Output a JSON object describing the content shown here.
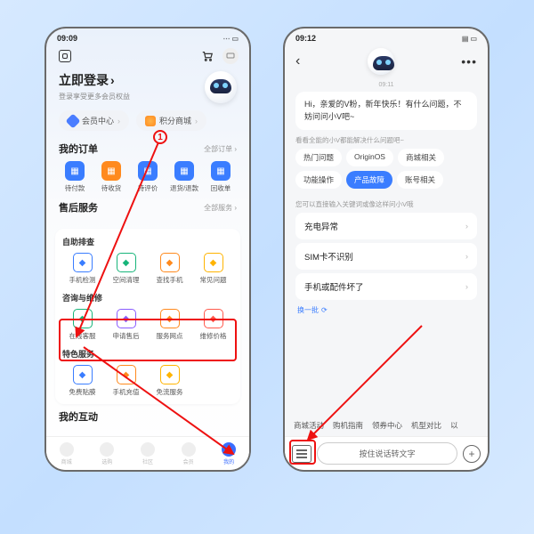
{
  "left": {
    "status_time": "09:09",
    "settings_icon": "hex",
    "login_title": "立即登录",
    "login_sub": "登录享受更多会员权益",
    "pill_member": "会员中心",
    "pill_points": "积分商城",
    "orders": {
      "title": "我的订单",
      "more": "全部订单 ›",
      "items": [
        {
          "label": "待付款",
          "color": "#3a7dff"
        },
        {
          "label": "待收货",
          "color": "#ff8a1e"
        },
        {
          "label": "待评价",
          "color": "#3a7dff"
        },
        {
          "label": "退货/退款",
          "color": "#3a7dff"
        },
        {
          "label": "回收单",
          "color": "#3a7dff"
        }
      ]
    },
    "after": {
      "title": "售后服务",
      "more": "全部服务 ›",
      "group1_label": "自助排查",
      "group1": [
        {
          "label": "手机检测",
          "color": "#3a7dff"
        },
        {
          "label": "空间清理",
          "color": "#17b57a"
        },
        {
          "label": "查找手机",
          "color": "#ff8a1e"
        },
        {
          "label": "常见问题",
          "color": "#ffb400"
        }
      ],
      "group2_label": "咨询与维修",
      "group2": [
        {
          "label": "在线客服",
          "color": "#17b57a"
        },
        {
          "label": "申请售后",
          "color": "#8a5cff"
        },
        {
          "label": "服务网点",
          "color": "#ff8a1e"
        },
        {
          "label": "维修价格",
          "color": "#ff5a4d"
        }
      ],
      "group3_label": "特色服务",
      "group3": [
        {
          "label": "免费贴膜",
          "color": "#3a7dff"
        },
        {
          "label": "手机充值",
          "color": "#ff8a1e"
        },
        {
          "label": "免流服务",
          "color": "#ffb400"
        }
      ]
    },
    "interact_title": "我的互动",
    "tabs": [
      {
        "label": "商城"
      },
      {
        "label": "选购"
      },
      {
        "label": "社区"
      },
      {
        "label": "会员"
      },
      {
        "label": "我的"
      }
    ]
  },
  "right": {
    "status_time": "09:12",
    "chat_time": "09:11",
    "greeting": "Hi，亲爱的V粉，新年快乐！有什么问题，不妨问问小V吧~",
    "hint1": "看看全能的小V都能解决什么问题吧~",
    "chips": [
      {
        "label": "热门问题"
      },
      {
        "label": "OriginOS"
      },
      {
        "label": "商城相关"
      },
      {
        "label": "功能操作"
      },
      {
        "label": "产品故障",
        "active": true
      },
      {
        "label": "账号相关"
      }
    ],
    "hint2": "您可以直接输入关键词或像这样问小V哦",
    "faq": [
      "充电异常",
      "SIM卡不识别",
      "手机或配件坏了"
    ],
    "refresh": "换一批",
    "quick": [
      "商城活动",
      "购机指南",
      "领券中心",
      "机型对比",
      "以"
    ],
    "voice_placeholder": "按住说话转文字"
  }
}
